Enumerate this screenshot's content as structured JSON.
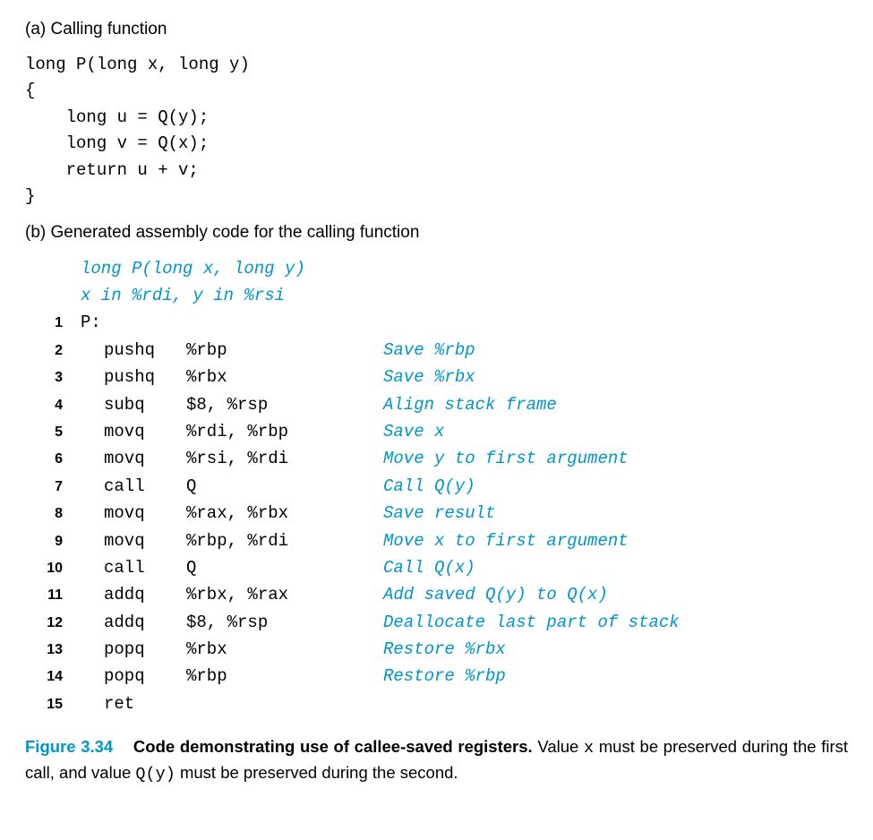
{
  "sectionA": {
    "label": "(a) Calling function",
    "code": "long P(long x, long y)\n{\n    long u = Q(y);\n    long v = Q(x);\n    return u + v;\n}"
  },
  "sectionB": {
    "label": "(b) Generated assembly code for the calling function",
    "header1": "long P(long x, long y)",
    "header2": "x in %rdi, y in %rsi",
    "rows": [
      {
        "n": "1",
        "label": "P:",
        "mn": "",
        "op": "",
        "c": ""
      },
      {
        "n": "2",
        "label": "",
        "mn": "pushq",
        "op": "%rbp",
        "c": "Save %rbp"
      },
      {
        "n": "3",
        "label": "",
        "mn": "pushq",
        "op": "%rbx",
        "c": "Save %rbx"
      },
      {
        "n": "4",
        "label": "",
        "mn": "subq",
        "op": "$8, %rsp",
        "c": "Align stack frame"
      },
      {
        "n": "5",
        "label": "",
        "mn": "movq",
        "op": "%rdi, %rbp",
        "c": "Save x"
      },
      {
        "n": "6",
        "label": "",
        "mn": "movq",
        "op": "%rsi, %rdi",
        "c": "Move y to first argument"
      },
      {
        "n": "7",
        "label": "",
        "mn": "call",
        "op": "Q",
        "c": "Call Q(y)"
      },
      {
        "n": "8",
        "label": "",
        "mn": "movq",
        "op": "%rax, %rbx",
        "c": "Save result"
      },
      {
        "n": "9",
        "label": "",
        "mn": "movq",
        "op": "%rbp, %rdi",
        "c": "Move x to first argument"
      },
      {
        "n": "10",
        "label": "",
        "mn": "call",
        "op": "Q",
        "c": "Call Q(x)"
      },
      {
        "n": "11",
        "label": "",
        "mn": "addq",
        "op": "%rbx, %rax",
        "c": "Add saved Q(y) to Q(x)"
      },
      {
        "n": "12",
        "label": "",
        "mn": "addq",
        "op": "$8, %rsp",
        "c": "Deallocate last part of stack"
      },
      {
        "n": "13",
        "label": "",
        "mn": "popq",
        "op": "%rbx",
        "c": "Restore %rbx"
      },
      {
        "n": "14",
        "label": "",
        "mn": "popq",
        "op": "%rbp",
        "c": "Restore %rbp"
      },
      {
        "n": "15",
        "label": "",
        "mn": "ret",
        "op": "",
        "c": ""
      }
    ]
  },
  "caption": {
    "figLabel": "Figure 3.34",
    "title": "Code demonstrating use of callee-saved registers.",
    "pre": " Value ",
    "m1": "x",
    "mid1": " must be preserved during the first call, and value ",
    "m2": "Q(y)",
    "post": " must be preserved during the second."
  }
}
